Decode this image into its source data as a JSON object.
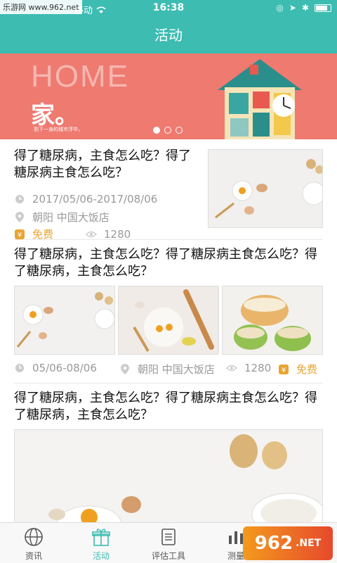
{
  "status": {
    "watermark": "乐游网 www.962.net",
    "carrier": "移动",
    "time": "16:38"
  },
  "nav": {
    "title": "活动"
  },
  "banner": {
    "home": "HOME",
    "jia": "家。",
    "caption": "割下一身的城市浮华，",
    "dots": 3,
    "active_dot": 0
  },
  "items": [
    {
      "title": "得了糖尿病，主食怎么吃？得了糖尿病主食怎么吃？",
      "date": "2017/05/06-2017/08/06",
      "location": "朝阳 中国大饭店",
      "price": "免费",
      "views": "1280"
    },
    {
      "title": "得了糖尿病，主食怎么吃？得了糖尿病主食怎么吃？得了糖尿病，主食怎么吃？",
      "date": "05/06-08/06",
      "location": "朝阳 中国大饭店",
      "views": "1280",
      "price": "免费"
    },
    {
      "title": "得了糖尿病，主食怎么吃？得了糖尿病主食怎么吃？得了糖尿病，主食怎么吃？"
    }
  ],
  "tabs": [
    {
      "label": "资讯",
      "icon": "globe-icon"
    },
    {
      "label": "活动",
      "icon": "gift-icon",
      "active": true
    },
    {
      "label": "评估工具",
      "icon": "list-icon"
    },
    {
      "label": "测量",
      "icon": "bars-icon"
    }
  ],
  "watermark_br": {
    "num": "962",
    "suffix": ".NET",
    "site": "乐游网"
  },
  "colors": {
    "accent": "#3dbcb2",
    "banner": "#ee7a70",
    "price": "#e8a531"
  }
}
